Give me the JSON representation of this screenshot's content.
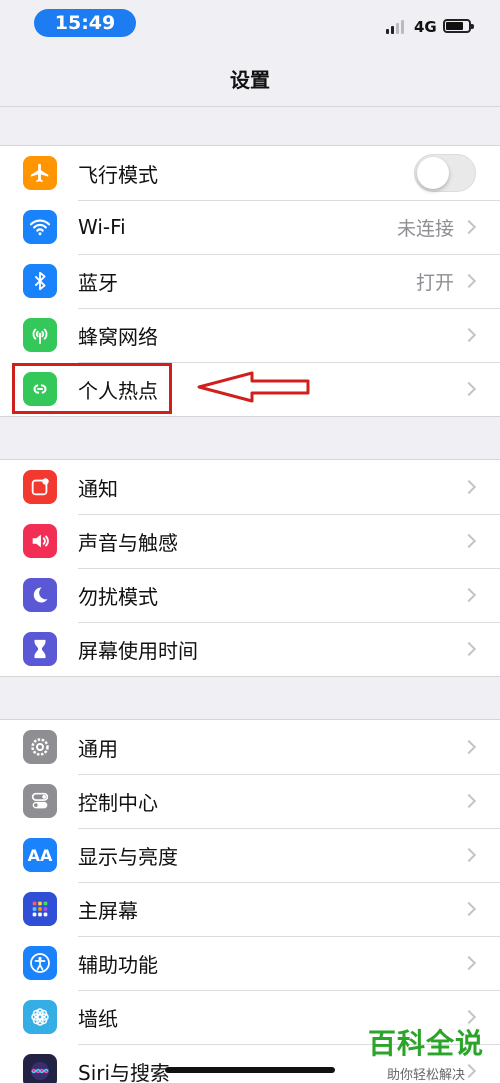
{
  "status_bar": {
    "time": "15:49",
    "network": "4G"
  },
  "nav": {
    "title": "设置"
  },
  "groups": [
    {
      "rows": [
        {
          "label": "飞行模式",
          "icon": "airplane-icon",
          "color": "#ff9500",
          "control": "toggle",
          "toggle_on": false
        },
        {
          "label": "Wi-Fi",
          "icon": "wifi-icon",
          "color": "#1a82fb",
          "value": "未连接"
        },
        {
          "label": "蓝牙",
          "icon": "bluetooth-icon",
          "color": "#1a82fb",
          "value": "打开"
        },
        {
          "label": "蜂窝网络",
          "icon": "antenna-icon",
          "color": "#34c759"
        },
        {
          "label": "个人热点",
          "icon": "hotspot-link-icon",
          "color": "#34c759"
        }
      ]
    },
    {
      "rows": [
        {
          "label": "通知",
          "icon": "notifications-icon",
          "color": "#f2392f"
        },
        {
          "label": "声音与触感",
          "icon": "speaker-icon",
          "color": "#f22e54"
        },
        {
          "label": "勿扰模式",
          "icon": "moon-icon",
          "color": "#5b58d6"
        },
        {
          "label": "屏幕使用时间",
          "icon": "hourglass-icon",
          "color": "#5b58d6"
        }
      ]
    },
    {
      "rows": [
        {
          "label": "通用",
          "icon": "gear-icon",
          "color": "#8e8e93"
        },
        {
          "label": "控制中心",
          "icon": "switches-icon",
          "color": "#8e8e93"
        },
        {
          "label": "显示与亮度",
          "icon": "text-size-icon",
          "color": "#1a82fb",
          "glyph": "AA"
        },
        {
          "label": "主屏幕",
          "icon": "home-grid-icon",
          "color": "#2e4fd6"
        },
        {
          "label": "辅助功能",
          "icon": "accessibility-icon",
          "color": "#1a82fb"
        },
        {
          "label": "墙纸",
          "icon": "flower-icon",
          "color": "#35aee6"
        },
        {
          "label": "Siri与搜索",
          "icon": "siri-icon",
          "color": "#222244"
        }
      ]
    }
  ],
  "annotation": {
    "highlight_color": "#d0201e"
  },
  "watermark": {
    "title": "百科全说",
    "subtitle": "助你轻松解决"
  }
}
